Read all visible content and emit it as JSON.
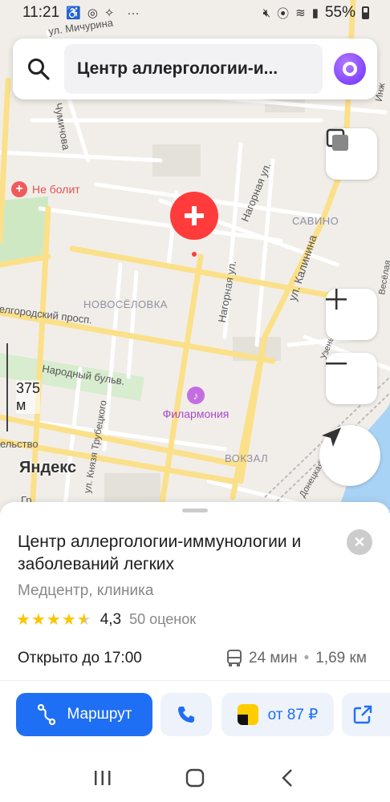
{
  "status_bar": {
    "time": "11:21",
    "battery": "55%",
    "more": "···"
  },
  "search": {
    "query": "Центр аллергологии-и..."
  },
  "map": {
    "labels": {
      "ne_bolit": "Не болит",
      "michurina": "ул. Мичурина",
      "chumichova": "Чумичова",
      "nagornaya1": "Нагорная ул.",
      "nagornaya2": "Нагорная ул.",
      "kalinina": "ул. Калинина",
      "savino": "САВИНО",
      "novoselovka": "НОВОСЁЛОВКА",
      "belgorodsky": "Белгородский просп.",
      "narodny": "Народный бульв.",
      "filarmoniya": "Филармония",
      "knyaz": "ул. Князя Трубецкого",
      "vokzal": "ВОКЗАЛ",
      "uzen": "Узенькая",
      "vesyolaya": "Весёлая",
      "donets": "Донецкая",
      "stvo": "ельство",
      "inzh": "Инж",
      "gr": "Гр"
    },
    "scale_text": "375 м",
    "logo": "Яндекс",
    "colors": {
      "background": "#f1eee9",
      "main_road": "#fbe08a",
      "minor_road": "#ffffff",
      "park": "#cfe8c4",
      "water": "#a9d3f5",
      "pin": "#ff3b3b"
    }
  },
  "organization": {
    "title": "Центр аллергологии-иммунологии и заболеваний легких",
    "category": "Медцентр, клиника",
    "rating": "4,3",
    "rating_value": 4.3,
    "rating_count": "50 оценок",
    "hours": "Открыто до 17:00",
    "transit_time": "24 мин",
    "distance": "1,69 км",
    "separator": "•"
  },
  "actions": {
    "route_label": "Маршрут",
    "taxi_label": "от 87 ₽"
  },
  "icons": {
    "search": "search-icon",
    "alice": "alice-icon",
    "layers": "layers-icon",
    "zoom_in": "plus-icon",
    "zoom_out": "minus-icon",
    "locate": "navigation-arrow-icon",
    "close": "close-icon",
    "bus": "bus-icon",
    "route": "route-icon",
    "phone": "phone-icon",
    "taxi": "taxi-icon",
    "share": "share-icon"
  },
  "accent_color": "#1f6ff5"
}
